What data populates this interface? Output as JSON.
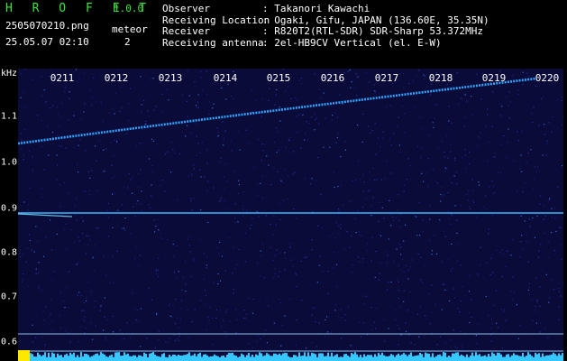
{
  "header": {
    "logo": "H R O F F T",
    "version": "1.0.0",
    "filename": "2505070210.png",
    "timestamp": "25.05.07 02:10",
    "meteor_label": "meteor",
    "meteor_count": "2",
    "observer_label": "Observer",
    "observer_value": ": Takanori Kawachi",
    "location_label": "Receiving Location",
    "location_value": ": Ogaki, Gifu, JAPAN (136.60E, 35.35N)",
    "receiver_label": "Receiver",
    "receiver_value": ": R820T2(RTL-SDR) SDR-Sharp 53.372MHz",
    "antenna_label": "Receiving antenna",
    "antenna_value": ": 2el-HB9CV Vertical (el. E-W)"
  },
  "spectrogram": {
    "y_unit": "kHz",
    "y_ticks": [
      "1.1",
      "1.0",
      "0.9",
      "0.8",
      "0.7",
      "0.6"
    ],
    "x_ticks": [
      "0211",
      "0212",
      "0213",
      "0214",
      "0215",
      "0216",
      "0217",
      "0218",
      "0219",
      "0220"
    ],
    "colors": {
      "background": "#0b0b3a",
      "signal": "#35b6ff",
      "label": "#ffffff",
      "logo": "#39e639"
    }
  }
}
